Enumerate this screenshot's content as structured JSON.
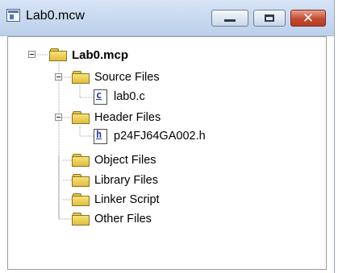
{
  "window": {
    "title": "Lab0.mcw",
    "icons": {
      "app": "workspace-icon",
      "minimize": "minimize-icon",
      "maximize": "maximize-icon",
      "close": "close-icon"
    },
    "close_glyph": "✕"
  },
  "tree": {
    "project": {
      "label": "Lab0.mcp",
      "icon": "folder-icon",
      "expanded": true
    },
    "source_files": {
      "label": "Source Files",
      "icon": "folder-icon",
      "expanded": true
    },
    "source_file": {
      "label": "lab0.c",
      "icon": "c-file-icon",
      "icon_letter": "c"
    },
    "header_files": {
      "label": "Header Files",
      "icon": "folder-icon",
      "expanded": true
    },
    "header_file": {
      "label": "p24FJ64GA002.h",
      "icon": "h-file-icon",
      "icon_letter": "h"
    },
    "object_files": {
      "label": "Object Files",
      "icon": "folder-icon"
    },
    "library_files": {
      "label": "Library Files",
      "icon": "folder-icon"
    },
    "linker_script": {
      "label": "Linker Script",
      "icon": "folder-icon"
    },
    "other_files": {
      "label": "Other Files",
      "icon": "folder-icon"
    }
  },
  "colors": {
    "titlebar": "#c7d8ef",
    "close_button": "#c34b32",
    "folder": "#f2d35c",
    "file_letter": "#2a3f9c"
  }
}
